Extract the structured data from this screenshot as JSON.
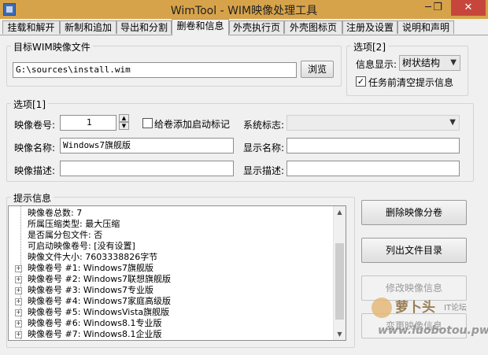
{
  "window": {
    "title": "WimTool - WIM映像处理工具",
    "minimize": "─",
    "restore": "❐",
    "close": "✕"
  },
  "tabs": [
    "挂载和解开",
    "新制和追加",
    "导出和分割",
    "删卷和信息",
    "外壳执行页",
    "外壳图标页",
    "注册及设置",
    "说明和声明"
  ],
  "target": {
    "group_label": "目标WIM映像文件",
    "path_value": "G:\\sources\\install.wim",
    "browse_label": "浏览"
  },
  "options2": {
    "group_label": "选项[2]",
    "display_label": "信息显示:",
    "display_value": "树状结构",
    "clear_label": "任务前清空提示信息",
    "clear_checked": true
  },
  "options1": {
    "group_label": "选项[1]",
    "volume_label": "映像卷号:",
    "volume_value": "1",
    "boot_label": "给卷添加启动标记",
    "boot_checked": false,
    "flag_label": "系统标志:",
    "flag_value": "",
    "name_label": "映像名称:",
    "name_value": "Windows7旗舰版",
    "display_name_label": "显示名称:",
    "display_name_value": "",
    "desc_label": "映像描述:",
    "desc_value": "",
    "display_desc_label": "显示描述:",
    "display_desc_value": ""
  },
  "info": {
    "group_label": "提示信息",
    "rows": [
      {
        "text": "映像卷总数: 7",
        "expandable": false
      },
      {
        "text": "所属压缩类型: 最大压缩",
        "expandable": false
      },
      {
        "text": "是否属分包文件: 否",
        "expandable": false
      },
      {
        "text": "可启动映像卷号: [没有设置]",
        "expandable": false
      },
      {
        "text": "映像文件大小: 7603338826字节",
        "expandable": false
      },
      {
        "text": "映像卷号 #1: Windows7旗舰版",
        "expandable": true
      },
      {
        "text": "映像卷号 #2: Windows7联想旗舰版",
        "expandable": true
      },
      {
        "text": "映像卷号 #3: Windows7专业版",
        "expandable": true
      },
      {
        "text": "映像卷号 #4: Windows7家庭高级版",
        "expandable": true
      },
      {
        "text": "映像卷号 #5: WindowsVista旗舰版",
        "expandable": true
      },
      {
        "text": "映像卷号 #6: Windows8.1专业版",
        "expandable": true
      },
      {
        "text": "映像卷号 #7: Windows8.1企业版",
        "expandable": true
      }
    ]
  },
  "actions": {
    "delete": "删除映像分卷",
    "list": "列出文件目录",
    "modify": "修改映像信息",
    "change": "变更映像信息"
  },
  "watermark": {
    "brand": "萝卜头",
    "suffix": "IT论坛",
    "url": "www.luobotou.pw"
  },
  "colors": {
    "titlebar": "#d7a34a",
    "close": "#c7463b"
  }
}
